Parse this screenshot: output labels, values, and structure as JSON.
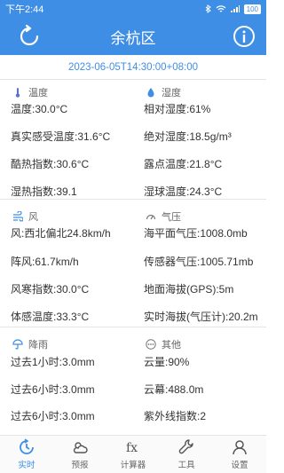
{
  "status": {
    "time": "下午2:44",
    "battery": "100"
  },
  "header": {
    "title": "余杭区"
  },
  "timestamp": "2023-06-05T14:30:00+08:00",
  "sections": {
    "temp": {
      "label": "温度",
      "left": [
        "温度:30.0°C",
        "真实感受温度:31.6°C",
        "酷热指数:30.6°C",
        "湿热指数:39.1"
      ]
    },
    "humid": {
      "label": "湿度",
      "right": [
        "相对湿度:61%",
        "绝对湿度:18.5g/m³",
        "露点温度:21.8°C",
        "湿球温度:24.3°C"
      ]
    },
    "wind": {
      "label": "风",
      "left": [
        "风:西北偏北24.8km/h",
        "阵风:61.7km/h",
        "风寒指数:30.0°C",
        "体感温度:33.3°C"
      ]
    },
    "pressure": {
      "label": "气压",
      "right": [
        "海平面气压:1008.0mb",
        "传感器气压:1005.71mb",
        "地面海拔(GPS):5m",
        "实时海拔(气压计):20.2m"
      ]
    },
    "rain": {
      "label": "降雨",
      "left": [
        "过去1小时:3.0mm",
        "过去6小时:3.0mm",
        "过去6小时:3.0mm"
      ]
    },
    "other": {
      "label": "其他",
      "right": [
        "云量:90%",
        "云幕:488.0m",
        "紫外线指数:2"
      ]
    }
  },
  "nav": [
    {
      "label": "实时",
      "icon": "realtime-icon"
    },
    {
      "label": "预报",
      "icon": "forecast-icon"
    },
    {
      "label": "计算器",
      "icon": "calculator-icon"
    },
    {
      "label": "工具",
      "icon": "wrench-icon"
    },
    {
      "label": "设置",
      "icon": "person-icon"
    }
  ]
}
